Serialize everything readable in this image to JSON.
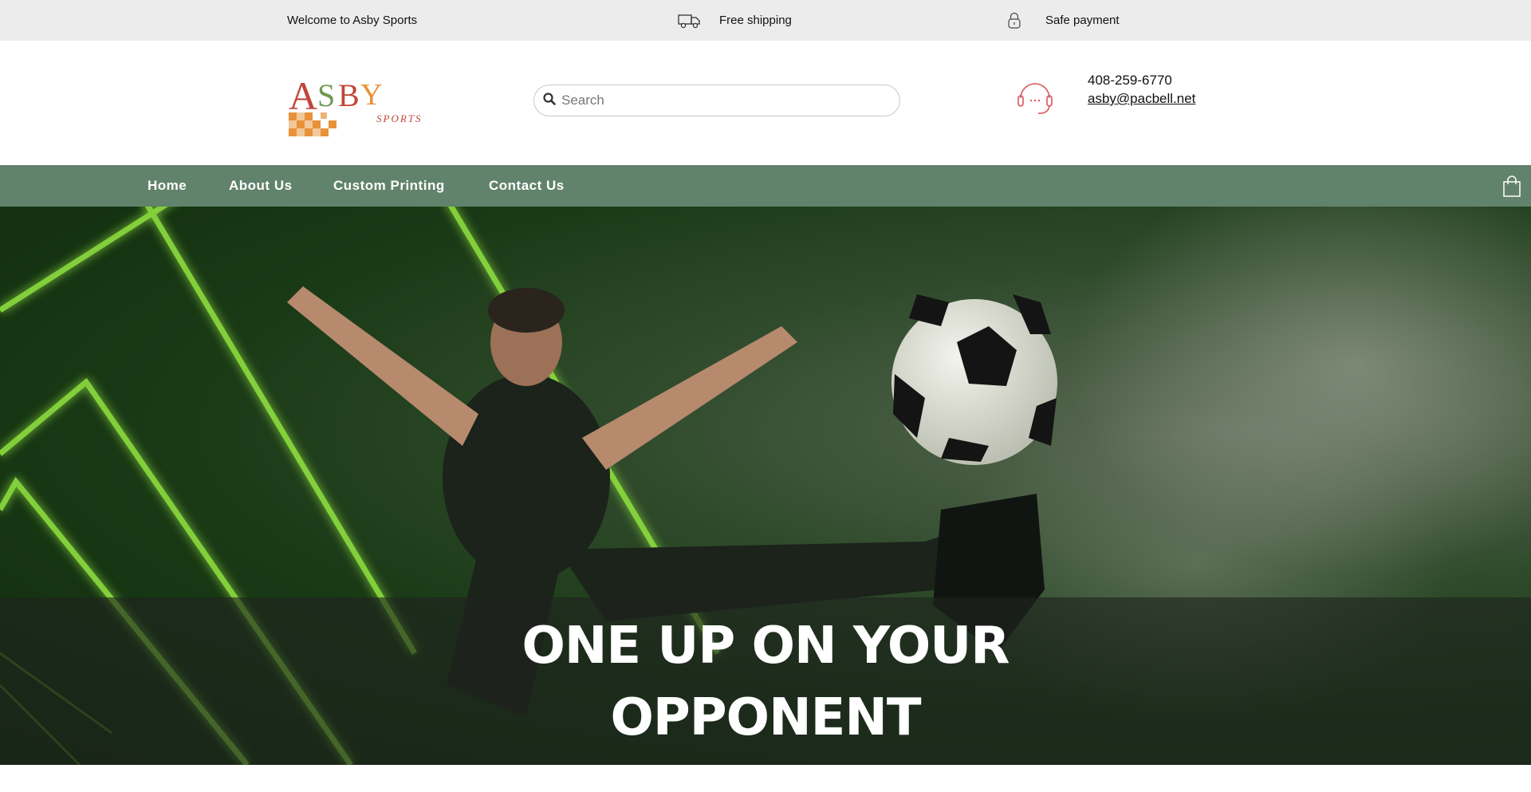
{
  "topbar": {
    "welcome": "Welcome to Asby Sports",
    "shipping": "Free shipping",
    "shipping_icon": "truck-icon",
    "payment": "Safe payment",
    "payment_icon": "lock-icon"
  },
  "header": {
    "logo_text": "ASBY",
    "logo_sub": "SPORTS",
    "search_placeholder": "Search",
    "support_icon": "headset-icon",
    "phone": "408-259-6770",
    "email": "asby@pacbell.net"
  },
  "nav": {
    "items": [
      {
        "label": "Home"
      },
      {
        "label": "About Us"
      },
      {
        "label": "Custom Printing"
      },
      {
        "label": "Contact Us"
      }
    ],
    "cart_icon": "shopping-bag-icon"
  },
  "hero": {
    "line1": "ONE UP ON YOUR",
    "line2": "OPPONENT"
  },
  "colors": {
    "topbar_bg": "#ececec",
    "nav_bg": "#62836b",
    "neon": "#8fe040",
    "logo_red": "#c0463a",
    "logo_orange": "#e8913a",
    "support_red": "#d9545a"
  }
}
